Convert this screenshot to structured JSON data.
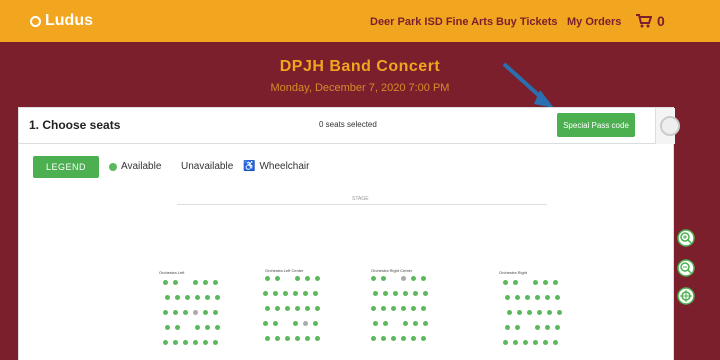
{
  "header": {
    "logo_text": "Ludus",
    "nav": [
      {
        "label": "Deer Park ISD Fine Arts"
      },
      {
        "label": "Buy Tickets"
      },
      {
        "label": "My Orders"
      }
    ],
    "cart_count": "0"
  },
  "event": {
    "title": "DPJH Band Concert",
    "date": "Monday, December 7, 2020 7:00 PM"
  },
  "seating": {
    "heading": "1. Choose seats",
    "selected_text": "0 seats selected",
    "special_button": "Special Pass code",
    "legend_button": "LEGEND",
    "legend": {
      "available": "Available",
      "unavailable": "Unavailable",
      "wheelchair": "Wheelchair"
    },
    "stage_label": "STAGE",
    "sections": [
      {
        "label": "Orchestra Left"
      },
      {
        "label": "Orchestra Left Center"
      },
      {
        "label": "Orchestra Right Center"
      },
      {
        "label": "Orchestra Right"
      }
    ]
  },
  "colors": {
    "brand_orange": "#f2a51f",
    "background_maroon": "#7a1f2b",
    "available_green": "#5cb85c",
    "unavailable_gray": "#aaaaaa"
  },
  "icons": [
    "cart-icon",
    "arrow-annotation-icon",
    "zoom-in-icon",
    "zoom-out-icon",
    "zoom-reset-icon",
    "wheelchair-icon"
  ]
}
